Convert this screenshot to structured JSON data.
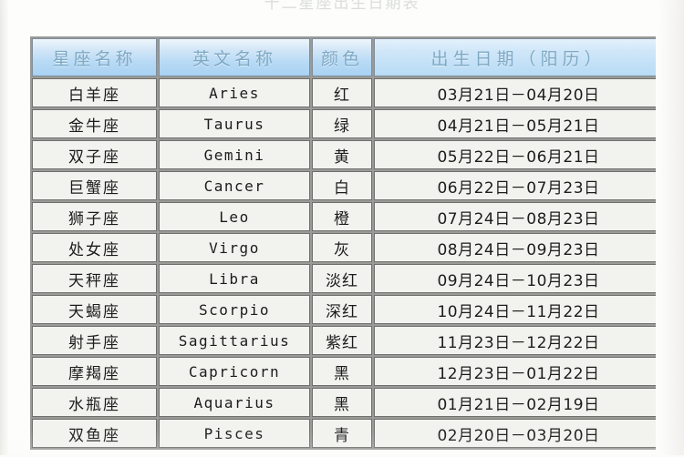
{
  "caption": {
    "text": "十二星座出生日期表"
  },
  "table": {
    "headers": [
      {
        "label": "星座名称",
        "key": "name"
      },
      {
        "label": "英文名称",
        "key": "english"
      },
      {
        "label": "颜色",
        "key": "color"
      },
      {
        "label": "出生日期（阳历）",
        "key": "date"
      }
    ],
    "rows": [
      {
        "name": "白羊座",
        "english": "Aries",
        "color": "红",
        "date": "03月21日－04月20日"
      },
      {
        "name": "金牛座",
        "english": "Taurus",
        "color": "绿",
        "date": "04月21日－05月21日"
      },
      {
        "name": "双子座",
        "english": "Gemini",
        "color": "黄",
        "date": "05月22日－06月21日"
      },
      {
        "name": "巨蟹座",
        "english": "Cancer",
        "color": "白",
        "date": "06月22日－07月23日"
      },
      {
        "name": "狮子座",
        "english": "Leo",
        "color": "橙",
        "date": "07月24日－08月23日"
      },
      {
        "name": "处女座",
        "english": "Virgo",
        "color": "灰",
        "date": "08月24日－09月23日"
      },
      {
        "name": "天秤座",
        "english": "Libra",
        "color": "淡红",
        "date": "09月24日－10月23日"
      },
      {
        "name": "天蝎座",
        "english": "Scorpio",
        "color": "深红",
        "date": "10月24日－11月22日"
      },
      {
        "name": "射手座",
        "english": "Sagittarius",
        "color": "紫红",
        "date": "11月23日－12月22日"
      },
      {
        "name": "摩羯座",
        "english": "Capricorn",
        "color": "黑",
        "date": "12月23日－01月22日"
      },
      {
        "name": "水瓶座",
        "english": "Aquarius",
        "color": "黑",
        "date": "01月21日－02月19日"
      },
      {
        "name": "双鱼座",
        "english": "Pisces",
        "color": "青",
        "date": "02月20日－03月20日"
      }
    ]
  },
  "colors": {
    "header_fill_top": "#eef6fc",
    "header_fill_bottom": "#a9d2f3",
    "header_text": "#7fa9c4",
    "cell_fill": "#f2f2ee",
    "cell_text": "#1c1c1c",
    "grid_line": "#6f6f6d",
    "page_background": "#fbfbf9"
  }
}
